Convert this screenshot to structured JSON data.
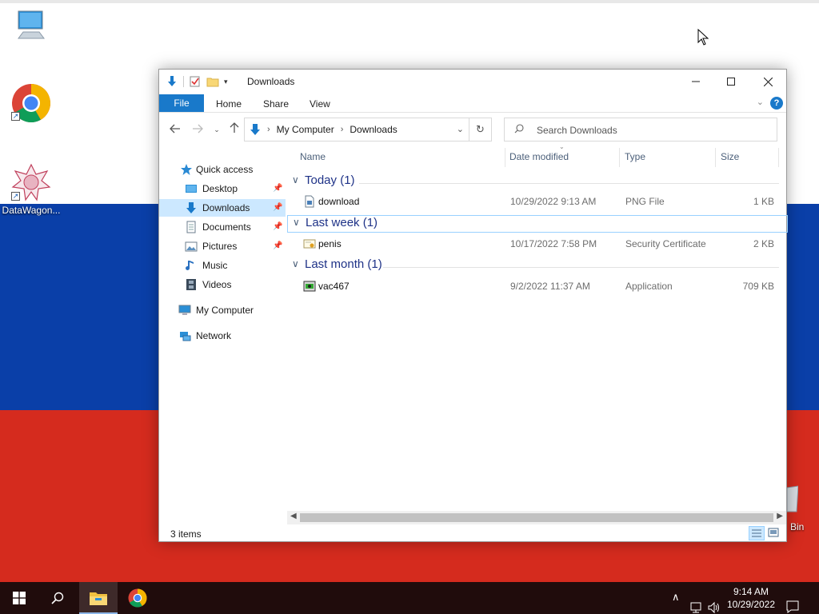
{
  "desktop": {
    "icons": [
      {
        "label": ""
      },
      {
        "label": ""
      },
      {
        "label": "DataWagon..."
      }
    ],
    "recycle_bin_label_partial": "Bin",
    "colors": {
      "white": "#ffffff",
      "blue": "#0a3fa8",
      "red": "#d52b1e"
    }
  },
  "window": {
    "title": "Downloads",
    "ribbon_tabs": [
      "File",
      "Home",
      "Share",
      "View"
    ],
    "address": {
      "segments": [
        "My Computer",
        "Downloads"
      ]
    },
    "search": {
      "placeholder": "Search Downloads"
    },
    "nav_pane": {
      "quick_access": "Quick access",
      "items": [
        {
          "label": "Desktop",
          "pinned": true
        },
        {
          "label": "Downloads",
          "pinned": true,
          "selected": true
        },
        {
          "label": "Documents",
          "pinned": true
        },
        {
          "label": "Pictures",
          "pinned": true
        },
        {
          "label": "Music",
          "pinned": false
        },
        {
          "label": "Videos",
          "pinned": false
        }
      ],
      "my_computer": "My Computer",
      "network": "Network"
    },
    "columns": {
      "name": "Name",
      "date": "Date modified",
      "type": "Type",
      "size": "Size"
    },
    "groups": [
      {
        "label": "Today (1)",
        "files": [
          {
            "name": "download",
            "date": "10/29/2022 9:13 AM",
            "type": "PNG File",
            "size": "1 KB",
            "icon": "image-file-icon"
          }
        ]
      },
      {
        "label": "Last week (1)",
        "files": [
          {
            "name": "penis",
            "date": "10/17/2022 7:58 PM",
            "type": "Security Certificate",
            "size": "2 KB",
            "icon": "certificate-icon"
          }
        ]
      },
      {
        "label": "Last month (1)",
        "files": [
          {
            "name": "vac467",
            "date": "9/2/2022 11:37 AM",
            "type": "Application",
            "size": "709 KB",
            "icon": "application-icon"
          }
        ]
      }
    ],
    "status": "3 items"
  },
  "taskbar": {
    "time": "9:14 AM",
    "date": "10/29/2022"
  }
}
